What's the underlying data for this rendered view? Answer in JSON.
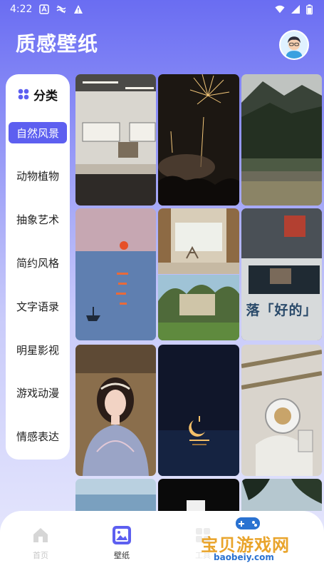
{
  "status_bar": {
    "time": "4:22"
  },
  "header": {
    "title": "质感壁纸"
  },
  "sidebar": {
    "header_label": "分类",
    "items": [
      {
        "label": "自然风景",
        "active": true
      },
      {
        "label": "动物植物"
      },
      {
        "label": "抽象艺术"
      },
      {
        "label": "简约风格"
      },
      {
        "label": "文字语录"
      },
      {
        "label": "明星影视"
      },
      {
        "label": "游戏动漫"
      },
      {
        "label": "情感表达"
      }
    ]
  },
  "grid": {
    "wallpapers": [
      {
        "subject": "subway-platform"
      },
      {
        "subject": "fireworks"
      },
      {
        "subject": "mountain-lake"
      },
      {
        "subject": "impressionist-sunrise"
      },
      {
        "subject": "patio-chairs"
      },
      {
        "subject": "garden-villa"
      },
      {
        "subject": "street-bus-sign",
        "sign_text": "落「好的」"
      },
      {
        "subject": "portrait-girl"
      },
      {
        "subject": "crescent-moon"
      },
      {
        "subject": "astronaut"
      },
      {
        "subject": "sea-horizon"
      },
      {
        "subject": "dark-room"
      },
      {
        "subject": "tree-sky"
      }
    ]
  },
  "bottom_nav": {
    "items": [
      {
        "label": "首页",
        "icon": "home-icon"
      },
      {
        "label": "壁纸",
        "icon": "wallpaper-icon",
        "active": true
      },
      {
        "label": "工具",
        "icon": "tools-icon"
      }
    ]
  },
  "watermark": {
    "title": "宝贝游戏网",
    "url": "baobeiy.com"
  },
  "colors": {
    "accent": "#5d5ff0",
    "watermark_orange": "#e9a42b",
    "watermark_blue": "#2a72d1"
  }
}
